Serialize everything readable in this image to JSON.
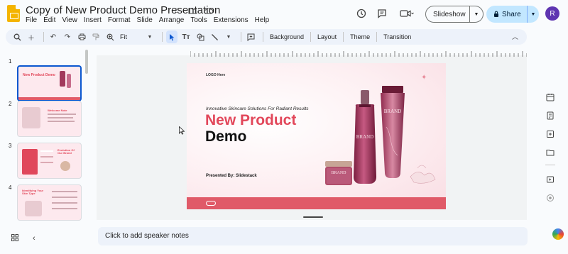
{
  "app": {
    "title": "Copy of New Product Demo Presentation",
    "menu": [
      "File",
      "Edit",
      "View",
      "Insert",
      "Format",
      "Slide",
      "Arrange",
      "Tools",
      "Extensions",
      "Help"
    ]
  },
  "header": {
    "slideshow_label": "Slideshow",
    "share_label": "Share",
    "avatar_initial": "R"
  },
  "toolbar": {
    "zoom": "Fit",
    "background_label": "Background",
    "layout_label": "Layout",
    "theme_label": "Theme",
    "transition_label": "Transition"
  },
  "filmstrip": {
    "slides": [
      {
        "number": "1",
        "title": "New Product Demo",
        "active": true
      },
      {
        "number": "2",
        "title": "Welcome Note",
        "active": false
      },
      {
        "number": "3",
        "title": "Evolution Of Our Brand",
        "active": false
      },
      {
        "number": "4",
        "title": "Identifying Your Skin Type",
        "active": false
      }
    ]
  },
  "slide": {
    "logo_text": "LOGO Here",
    "tagline": "Innovative Skincare Solutions For Radiant Results",
    "heading_line1": "New Product",
    "heading_line2": "Demo",
    "presented_by": "Presented By: Slidestack",
    "brand_text": "BRAND",
    "accent_color": "#e2475a",
    "footer_color": "#e05a68"
  },
  "notes": {
    "placeholder": "Click to add speaker notes"
  }
}
